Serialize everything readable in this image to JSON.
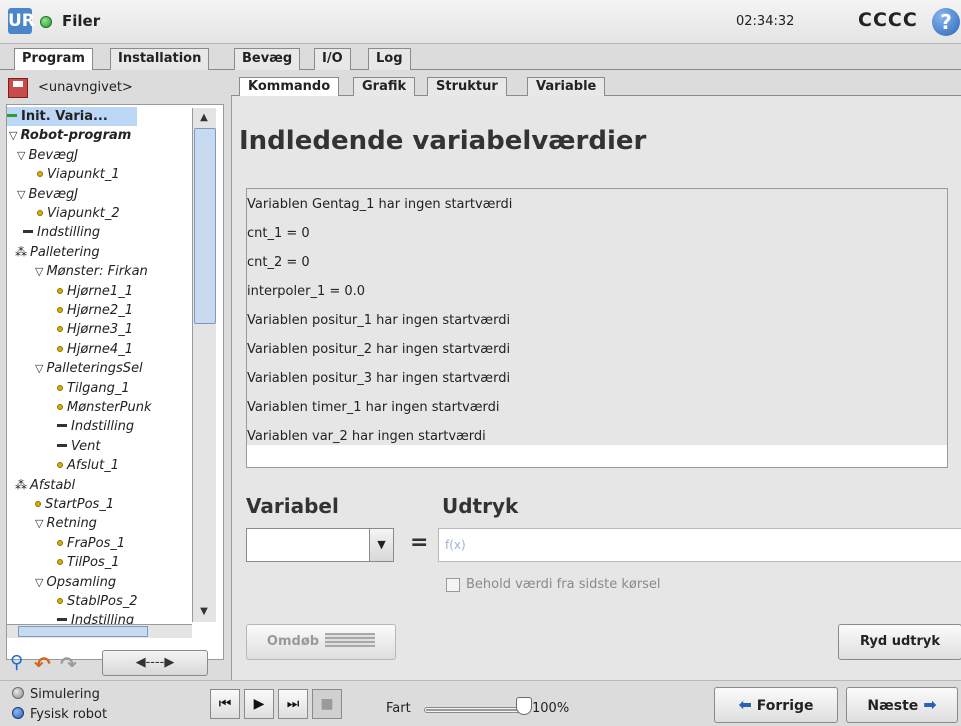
{
  "topbar": {
    "logo": "UR",
    "app_title": "Filer",
    "clock": "02:34:32",
    "robot_name": "CCCC",
    "help": "?",
    "status_color": "#2e9a2e"
  },
  "main_tabs": [
    "Program",
    "Installation",
    "Bevæg",
    "I/O",
    "Log"
  ],
  "sub_tabs": [
    "Kommando",
    "Grafik",
    "Struktur",
    "Variable"
  ],
  "file": {
    "name": "<unavngivet>"
  },
  "tree": [
    {
      "label": "Init. Varia...",
      "kind": "dash-green",
      "bold": true,
      "selected": true
    },
    {
      "label": "Robot-program",
      "kind": "tri",
      "bold": true
    },
    {
      "label": "BevægJ",
      "kind": "tri"
    },
    {
      "label": "Viapunkt_1",
      "kind": "dot"
    },
    {
      "label": "BevægJ",
      "kind": "tri"
    },
    {
      "label": "Viapunkt_2",
      "kind": "dot"
    },
    {
      "label": "Indstilling",
      "kind": "dash"
    },
    {
      "label": "Palletering",
      "kind": "pallet"
    },
    {
      "label": "Mønster: Firkan",
      "kind": "tri"
    },
    {
      "label": "Hjørne1_1",
      "kind": "dot"
    },
    {
      "label": "Hjørne2_1",
      "kind": "dot"
    },
    {
      "label": "Hjørne3_1",
      "kind": "dot"
    },
    {
      "label": "Hjørne4_1",
      "kind": "dot"
    },
    {
      "label": "PalleteringsSel",
      "kind": "tri"
    },
    {
      "label": "Tilgang_1",
      "kind": "dot"
    },
    {
      "label": "MønsterPunk",
      "kind": "dot"
    },
    {
      "label": "Indstilling",
      "kind": "dash"
    },
    {
      "label": "Vent",
      "kind": "dash"
    },
    {
      "label": "Afslut_1",
      "kind": "dot"
    },
    {
      "label": "Afstabl",
      "kind": "pallet"
    },
    {
      "label": "StartPos_1",
      "kind": "dot"
    },
    {
      "label": "Retning",
      "kind": "tri"
    },
    {
      "label": "FraPos_1",
      "kind": "dot"
    },
    {
      "label": "TilPos_1",
      "kind": "dot"
    },
    {
      "label": "Opsamling",
      "kind": "tri"
    },
    {
      "label": "StablPos_2",
      "kind": "dot"
    },
    {
      "label": "Indstilling",
      "kind": "dash"
    }
  ],
  "tools": {
    "move_label": "◀----▶"
  },
  "content": {
    "heading": "Indledende variabelværdier",
    "var_lines": [
      "Variablen Gentag_1 har ingen startværdi",
      "cnt_1 = 0",
      "cnt_2 = 0",
      "interpoler_1 = 0.0",
      "Variablen positur_1 har ingen startværdi",
      "Variablen positur_2 har ingen startværdi",
      "Variablen positur_3 har ingen startværdi",
      "Variablen timer_1 har ingen startværdi",
      "Variablen var_2 har ingen startværdi"
    ],
    "variabel_label": "Variabel",
    "udtryk_label": "Udtryk",
    "equals": "=",
    "expr_placeholder": "f(x)",
    "keep_value_label": "Behold værdi fra sidste kørsel",
    "rename_label": "Omdøb",
    "clear_label": "Ryd udtryk"
  },
  "bottom": {
    "simulation_label": "Simulering",
    "physical_label": "Fysisk robot",
    "speed_label": "Fart",
    "speed_value": "100%",
    "speed_fraction": 1.0,
    "prev_label": "Forrige",
    "next_label": "Næste"
  }
}
